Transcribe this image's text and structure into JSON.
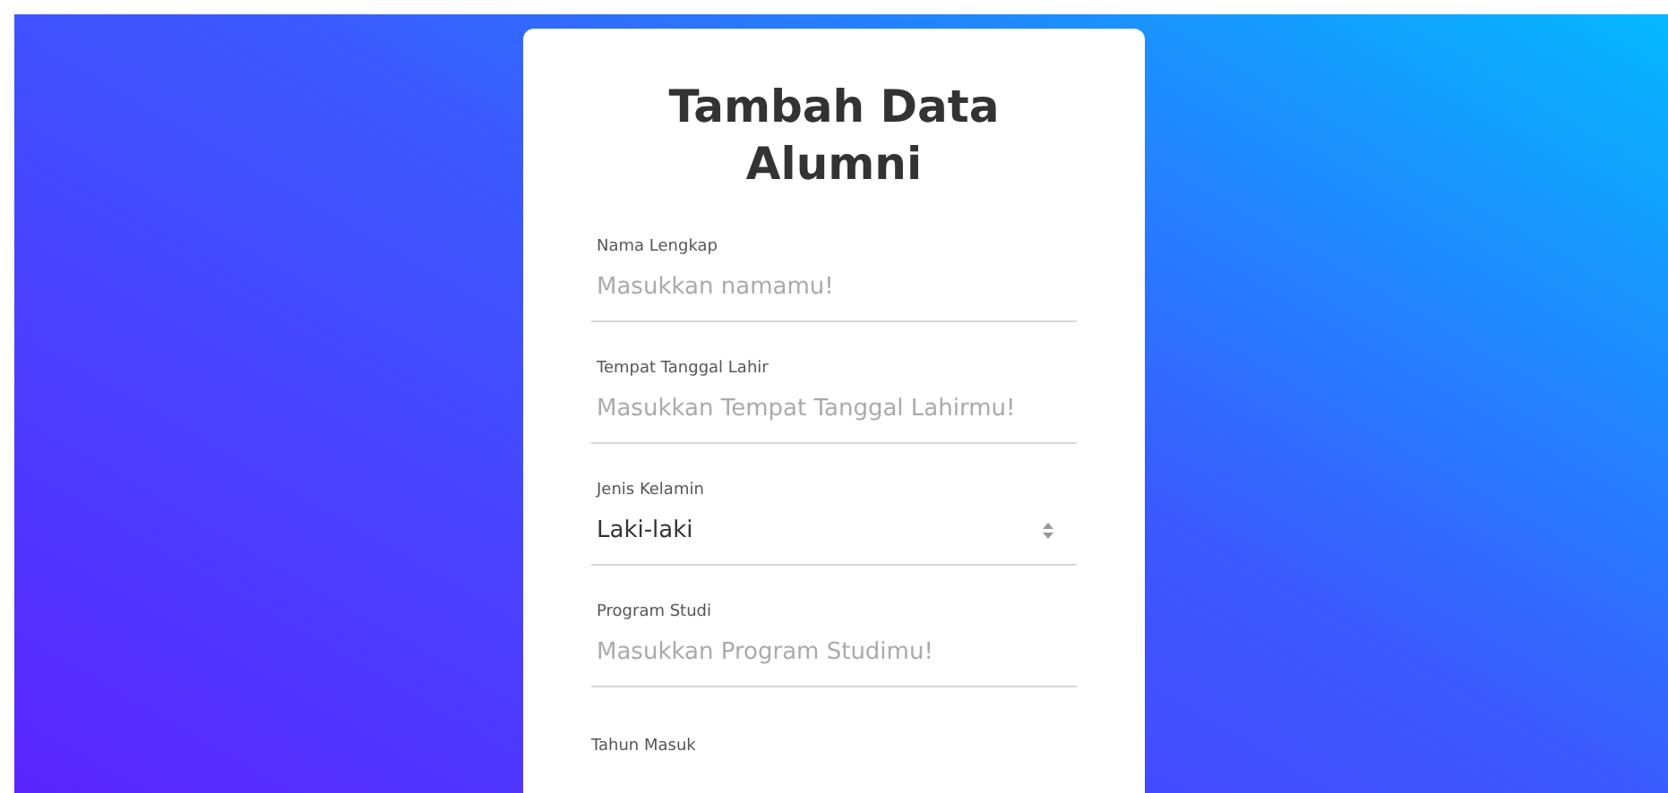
{
  "form": {
    "title": "Tambah Data Alumni",
    "fields": [
      {
        "kind": "input",
        "label": "Nama Lengkap",
        "placeholder": "Masukkan namamu!"
      },
      {
        "kind": "input",
        "label": "Tempat Tanggal Lahir",
        "placeholder": "Masukkan Tempat Tanggal Lahirmu!"
      },
      {
        "kind": "select",
        "label": "Jenis Kelamin",
        "value": "Laki-laki"
      },
      {
        "kind": "input",
        "label": "Program Studi",
        "placeholder": "Masukkan Program Studimu!"
      },
      {
        "kind": "label",
        "label": "Tahun Masuk"
      }
    ]
  }
}
